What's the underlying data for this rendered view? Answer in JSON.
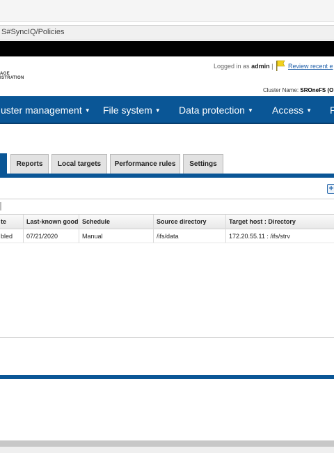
{
  "browser": {
    "address": "S#SyncIQ/Policies"
  },
  "header": {
    "logo_line1": "AGE",
    "logo_line2": "ISTRATION",
    "logged_in_prefix": "Logged in as",
    "user": "admin",
    "review_link": "Review recent e",
    "cluster_label": "Cluster Name:",
    "cluster_name": "SROneFS (O"
  },
  "nav": {
    "items": [
      {
        "label": "uster management"
      },
      {
        "label": "File system"
      },
      {
        "label": "Data protection"
      },
      {
        "label": "Access"
      },
      {
        "label": "P"
      }
    ]
  },
  "tabs": [
    "Reports",
    "Local targets",
    "Performance rules",
    "Settings"
  ],
  "table": {
    "columns": [
      "te",
      "Last-known good",
      "Schedule",
      "Source directory",
      "Target host : Directory"
    ],
    "rows": [
      [
        "bled",
        "07/21/2020",
        "Manual",
        "/ifs/data",
        "172.20.55.11 : /ifs/strv"
      ]
    ]
  },
  "colors": {
    "accent": "#0a5696",
    "link": "#1f5fa9"
  }
}
